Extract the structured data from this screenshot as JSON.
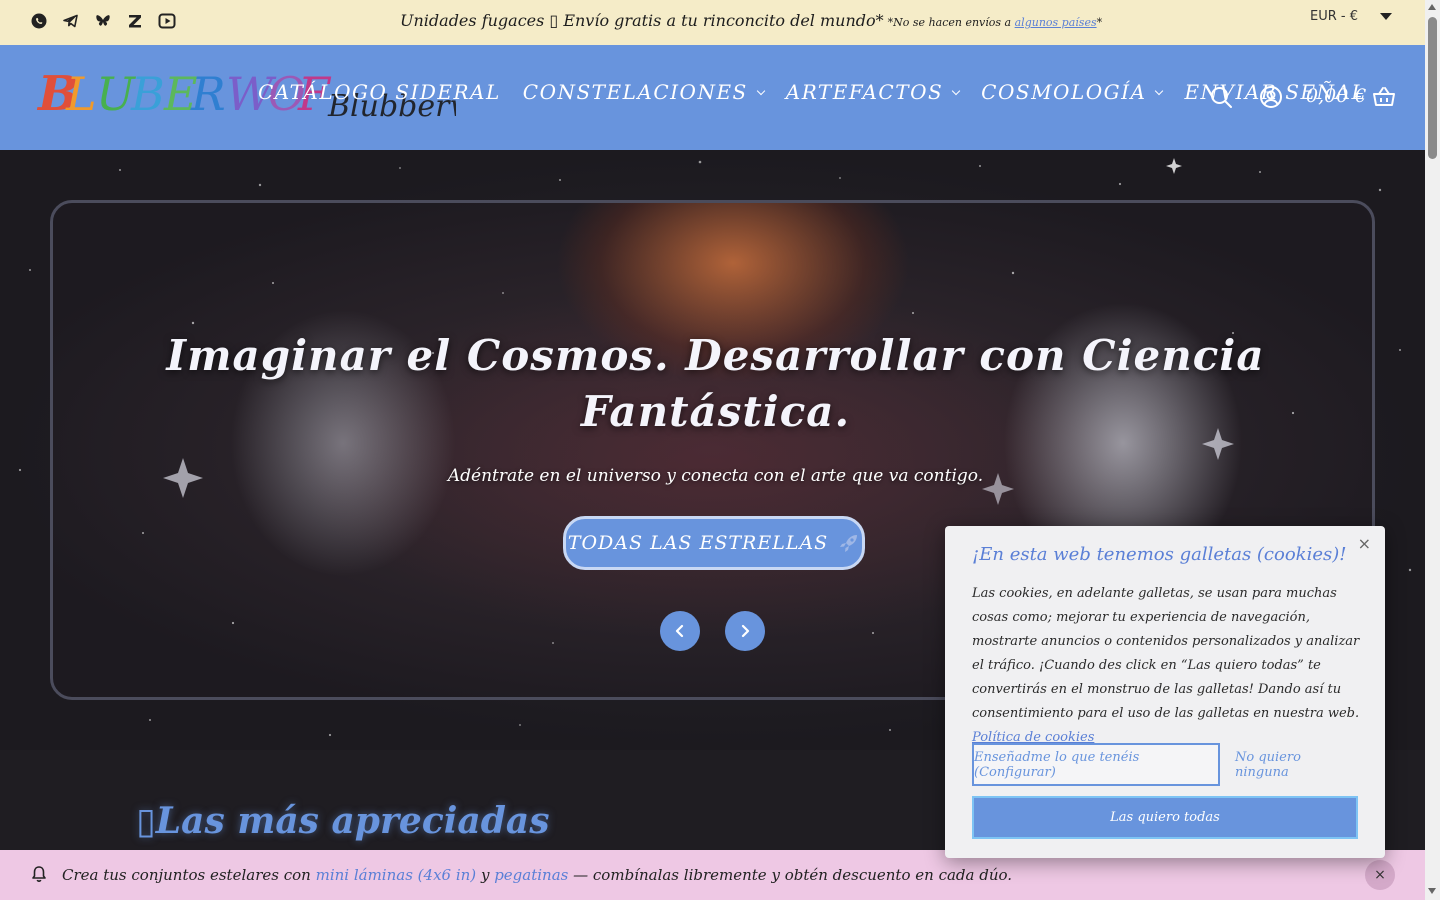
{
  "topbar": {
    "social_icons": [
      "whatsapp-icon",
      "telegram-icon",
      "bluesky-icon",
      "kofi-icon",
      "youtube-icon"
    ],
    "announcement": "Unidades fugaces ▯ Envío gratis a tu rinconcito del mundo*",
    "note_prefix": "*No se hacen envíos a",
    "note_link": "algunos países",
    "note_suffix": "*",
    "currency": "EUR - €"
  },
  "header": {
    "logo_text": "Blubberwolf Universe",
    "nav": [
      {
        "label": "CATÁLOGO SIDERAL",
        "has_dropdown": false
      },
      {
        "label": "CONSTELACIONES",
        "has_dropdown": true
      },
      {
        "label": "ARTEFACTOS",
        "has_dropdown": true
      },
      {
        "label": "COSMOLOGÍA",
        "has_dropdown": true
      },
      {
        "label": "ENVIAR SEÑAL",
        "has_dropdown": false
      }
    ],
    "cart_total": "0,00 €"
  },
  "hero": {
    "title": "Imaginar el Cosmos. Desarrollar con Ciencia Fantástica.",
    "subtitle": "Adéntrate en el universo y conecta con el arte que va contigo.",
    "button": "TODAS LAS ESTRELLAS"
  },
  "section": {
    "title": "▯Las más apreciadas"
  },
  "bottombar": {
    "text_start": "Crea tus conjuntos estelares con",
    "link1": "mini láminas (4x6 in)",
    "text_mid": "y",
    "link2": "pegatinas",
    "text_end": "— combínalas libremente y obtén descuento en cada dúo.",
    "close": "×"
  },
  "cookie": {
    "title": "¡En esta web tenemos galletas (cookies)!",
    "body": "Las cookies, en adelante galletas, se usan para muchas cosas como; mejorar tu experiencia de navegación, mostrarte anuncios o contenidos personalizados y analizar el tráfico. ¡Cuando des click en “Las quiero todas” te convertirás en el monstruo de las galletas! Dando así tu consentimiento para el uso de las galletas en nuestra web.",
    "policy_link": "Política de cookies",
    "close": "×",
    "btn_config": "Enseñadme lo que tenéis (Configurar)",
    "btn_none": "No quiero ninguna",
    "btn_all": "Las quiero todas"
  },
  "colors": {
    "accent": "#6894dd",
    "topbar_bg": "#f5ecc8",
    "bottombar_bg": "#eec8e4",
    "page_bg": "#1f1d22"
  }
}
